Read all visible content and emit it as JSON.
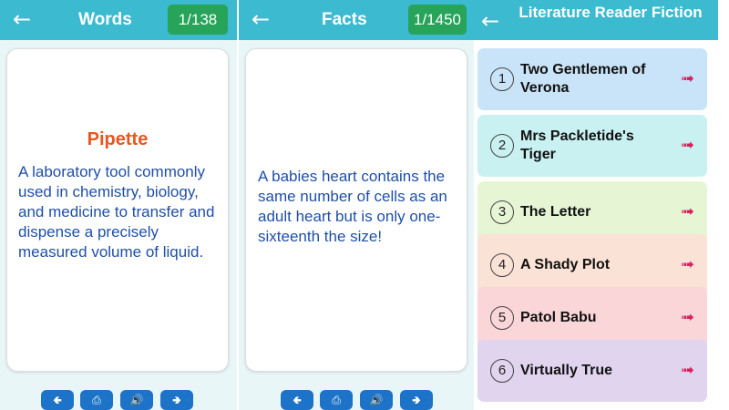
{
  "words": {
    "title": "Words",
    "counter": "1/138",
    "term": "Pipette",
    "definition": "A laboratory tool commonly used in chemistry, biology, and medicine to transfer and dispense a precisely measured volume of liquid."
  },
  "facts": {
    "title": "Facts",
    "counter": "1/1450",
    "text": "A babies heart contains the same number of cells as an adult heart but is only one-sixteenth the size!"
  },
  "literature": {
    "title": "Literature Reader Fiction",
    "items": [
      {
        "number": "1",
        "title": "Two Gentlemen of Verona",
        "color": "#c9e3f8"
      },
      {
        "number": "2",
        "title": "Mrs Packletide's Tiger",
        "color": "#c9f1f1"
      },
      {
        "number": "3",
        "title": "The Letter",
        "color": "#e6f6d5"
      },
      {
        "number": "4",
        "title": "A Shady Plot",
        "color": "#fbe2d6"
      },
      {
        "number": "5",
        "title": "Patol Babu",
        "color": "#fad6d9"
      },
      {
        "number": "6",
        "title": "Virtually True",
        "color": "#e0d4ef"
      }
    ]
  },
  "icons": {
    "back": "arrow-left-icon",
    "previous": "previous-arrow-icon",
    "share": "share-icon",
    "speak": "speaker-icon",
    "next": "next-arrow-icon",
    "open": "open-arrow-icon"
  },
  "colors": {
    "header": "#3bbad0",
    "counter": "#27a35a",
    "term": "#e8561f",
    "text": "#1f4fa8",
    "button": "#1d73c7"
  }
}
